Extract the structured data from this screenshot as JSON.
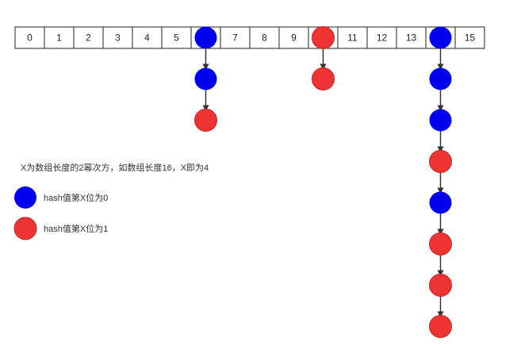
{
  "array": {
    "cells": [
      "0",
      "1",
      "2",
      "3",
      "4",
      "5",
      "",
      "7",
      "8",
      "9",
      "",
      "11",
      "12",
      "13",
      "",
      "15"
    ]
  },
  "colors": {
    "blue": "#0000ee",
    "red": "#ee3333",
    "arrow": "#333333",
    "grid": "#222222"
  },
  "chains": [
    {
      "bucket": 6,
      "nodes": [
        "blue",
        "blue",
        "red"
      ]
    },
    {
      "bucket": 10,
      "nodes": [
        "red",
        "red"
      ]
    },
    {
      "bucket": 14,
      "nodes": [
        "blue",
        "blue",
        "blue",
        "red",
        "blue",
        "red",
        "red",
        "red"
      ]
    }
  ],
  "notes": {
    "description": "X为数组长度的2幂次方，如数组长度16，X即为4"
  },
  "legend": {
    "blue_label": "hash值第X位为0",
    "red_label": "hash值第X位为1"
  }
}
